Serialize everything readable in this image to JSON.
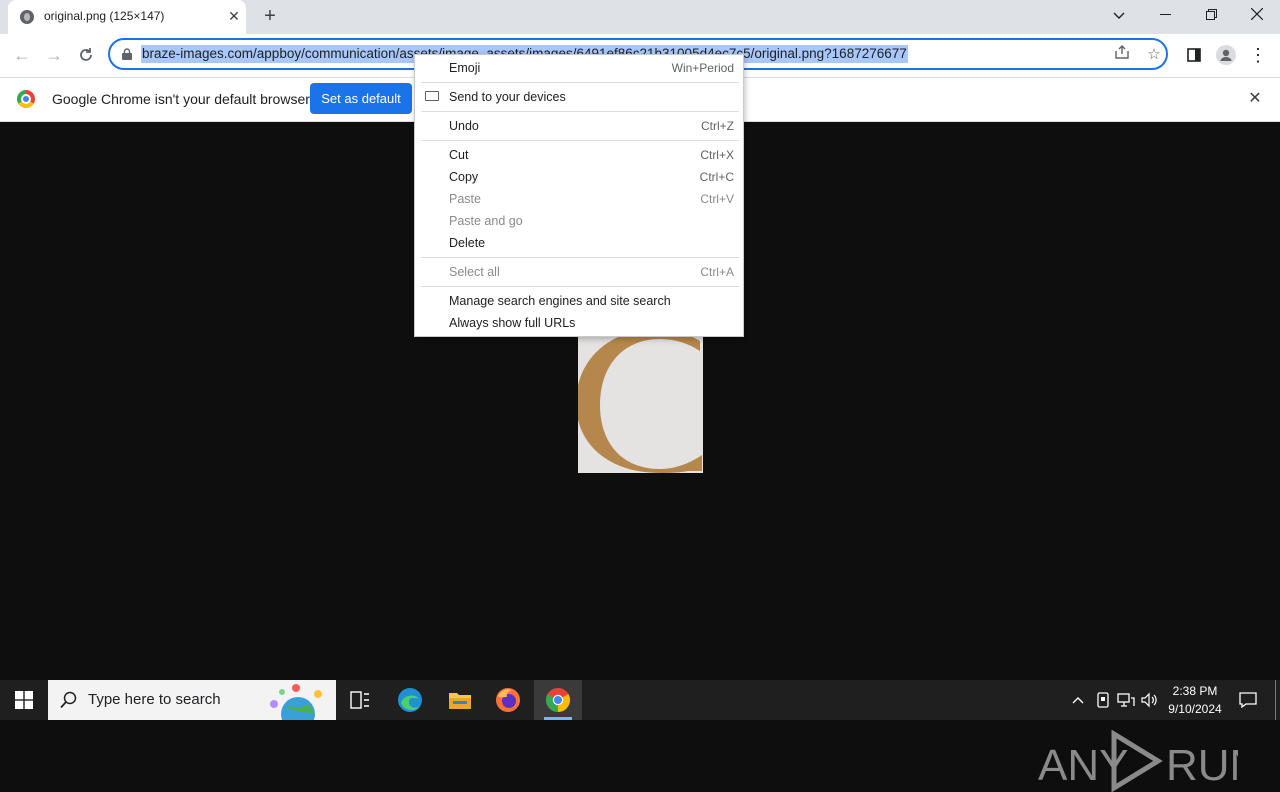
{
  "browser": {
    "tab_title": "original.png (125×147)",
    "url_visible": "braze-images.com/appboy/communication/assets/image_assets/images/6491ef86c21b31005d4ec7c5/original.png?1687276677"
  },
  "infobar": {
    "message": "Google Chrome isn't your default browser",
    "set_default_label": "Set as default"
  },
  "context_menu": {
    "items": [
      {
        "label": "Emoji",
        "shortcut": "Win+Period",
        "enabled": true
      },
      {
        "label": "Send to your devices",
        "shortcut": "",
        "enabled": true
      },
      {
        "label": "Undo",
        "shortcut": "Ctrl+Z",
        "enabled": true
      },
      {
        "label": "Cut",
        "shortcut": "Ctrl+X",
        "enabled": true
      },
      {
        "label": "Copy",
        "shortcut": "Ctrl+C",
        "enabled": true
      },
      {
        "label": "Paste",
        "shortcut": "Ctrl+V",
        "enabled": false
      },
      {
        "label": "Paste and go",
        "shortcut": "",
        "enabled": false
      },
      {
        "label": "Delete",
        "shortcut": "",
        "enabled": true
      },
      {
        "label": "Select all",
        "shortcut": "Ctrl+A",
        "enabled": false
      },
      {
        "label": "Manage search engines and site search",
        "shortcut": "",
        "enabled": true
      },
      {
        "label": "Always show full URLs",
        "shortcut": "",
        "enabled": true
      }
    ]
  },
  "watermark": {
    "text_left": "ANY",
    "text_right": "RUN"
  },
  "taskbar": {
    "search_placeholder": "Type here to search",
    "time": "2:38 PM",
    "date": "9/10/2024"
  },
  "colors": {
    "accent": "#1a73e8",
    "image_letter": "#b5874c",
    "image_bg": "#e4e3e1"
  }
}
